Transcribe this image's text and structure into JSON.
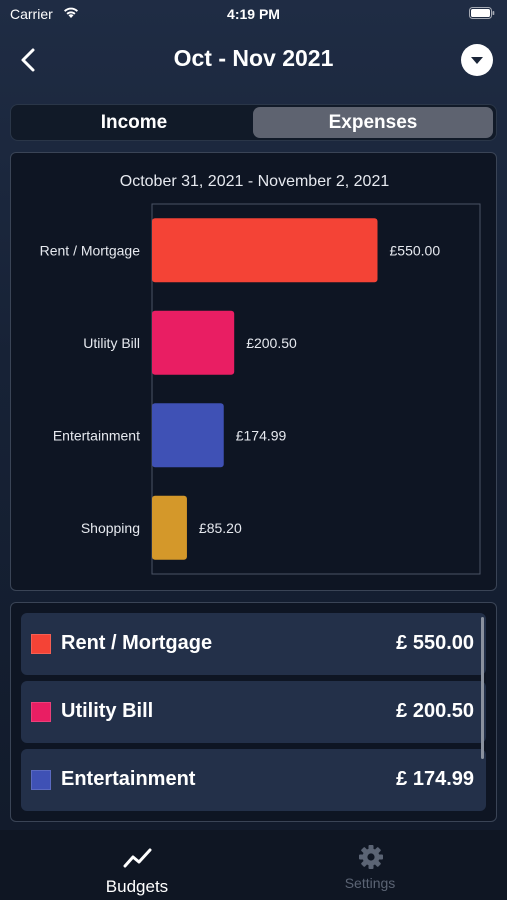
{
  "status_bar": {
    "carrier": "Carrier",
    "time": "4:19 PM"
  },
  "nav": {
    "title": "Oct - Nov 2021"
  },
  "segment": {
    "income_label": "Income",
    "expenses_label": "Expenses",
    "selected": "Expenses"
  },
  "chart_data": {
    "type": "bar",
    "orientation": "horizontal",
    "title": "October 31, 2021 - November 2, 2021",
    "categories": [
      "Rent / Mortgage",
      "Utility Bill",
      "Entertainment",
      "Shopping"
    ],
    "values": [
      550.0,
      200.5,
      174.99,
      85.2
    ],
    "value_labels": [
      "£550.00",
      "£200.50",
      "£174.99",
      "£85.20"
    ],
    "colors": [
      "#f44336",
      "#e91e63",
      "#3f51b5",
      "#d4982a"
    ],
    "xlim": [
      0,
      800
    ],
    "grid": false
  },
  "list": {
    "items": [
      {
        "label": "Rent / Mortgage",
        "amount": "£ 550.00",
        "color": "#f44336"
      },
      {
        "label": "Utility Bill",
        "amount": "£ 200.50",
        "color": "#e91e63"
      },
      {
        "label": "Entertainment",
        "amount": "£ 174.99",
        "color": "#3f51b5"
      }
    ]
  },
  "tabs": {
    "budgets_label": "Budgets",
    "settings_label": "Settings",
    "selected": "Budgets"
  }
}
